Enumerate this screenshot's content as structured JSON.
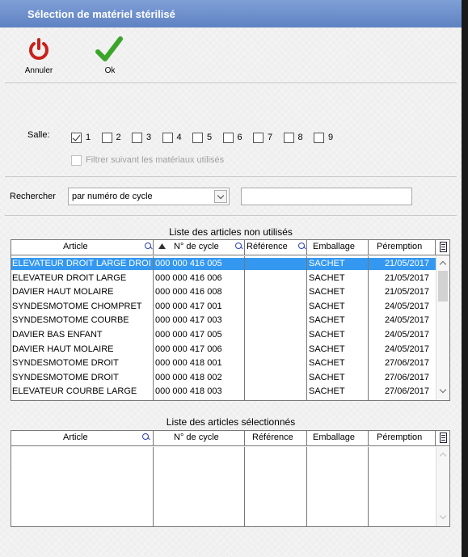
{
  "window": {
    "title": "Sélection de matériel stérilisé"
  },
  "toolbar": {
    "cancel_label": "Annuler",
    "ok_label": "Ok"
  },
  "salle": {
    "label": "Salle:",
    "rooms": [
      {
        "label": "1",
        "checked": true
      },
      {
        "label": "2",
        "checked": false
      },
      {
        "label": "3",
        "checked": false
      },
      {
        "label": "4",
        "checked": false
      },
      {
        "label": "5",
        "checked": false
      },
      {
        "label": "6",
        "checked": false
      },
      {
        "label": "7",
        "checked": false
      },
      {
        "label": "8",
        "checked": false
      },
      {
        "label": "9",
        "checked": false
      }
    ],
    "filter_label": "Filtrer suivant les matériaux utilisés"
  },
  "search": {
    "label": "Rechercher",
    "mode_value": "par numéro de cycle",
    "input_value": ""
  },
  "columns": {
    "article": "Article",
    "cycle": "N° de cycle",
    "reference": "Référence",
    "emballage": "Emballage",
    "peremption": "Péremption"
  },
  "unused": {
    "title": "Liste des articles non utilisés",
    "rows": [
      {
        "article": "ELEVATEUR DROIT LARGE  DROIT",
        "cycle": "000 000 416 005",
        "reference": "",
        "emballage": "SACHET",
        "peremption": "21/05/2017",
        "selected": true
      },
      {
        "article": "ELEVATEUR DROIT LARGE",
        "cycle": "000 000 416 006",
        "reference": "",
        "emballage": "SACHET",
        "peremption": "21/05/2017"
      },
      {
        "article": "DAVIER HAUT MOLAIRE",
        "cycle": "000 000 416 008",
        "reference": "",
        "emballage": "SACHET",
        "peremption": "21/05/2017"
      },
      {
        "article": "SYNDESMOTOME CHOMPRET",
        "cycle": "000 000 417 001",
        "reference": "",
        "emballage": "SACHET",
        "peremption": "24/05/2017"
      },
      {
        "article": "SYNDESMOTOME COURBE",
        "cycle": "000 000 417 003",
        "reference": "",
        "emballage": "SACHET",
        "peremption": "24/05/2017"
      },
      {
        "article": "DAVIER BAS ENFANT",
        "cycle": "000 000 417 005",
        "reference": "",
        "emballage": "SACHET",
        "peremption": "24/05/2017"
      },
      {
        "article": "DAVIER HAUT MOLAIRE",
        "cycle": "000 000 417 006",
        "reference": "",
        "emballage": "SACHET",
        "peremption": "24/05/2017"
      },
      {
        "article": "SYNDESMOTOME DROIT",
        "cycle": "000 000 418 001",
        "reference": "",
        "emballage": "SACHET",
        "peremption": "27/06/2017"
      },
      {
        "article": "SYNDESMOTOME DROIT",
        "cycle": "000 000 418 002",
        "reference": "",
        "emballage": "SACHET",
        "peremption": "27/06/2017"
      },
      {
        "article": "ELEVATEUR COURBE LARGE",
        "cycle": "000 000 418 003",
        "reference": "",
        "emballage": "SACHET",
        "peremption": "27/06/2017"
      }
    ]
  },
  "selected_list": {
    "title": "Liste des articles sélectionnés",
    "rows": []
  }
}
